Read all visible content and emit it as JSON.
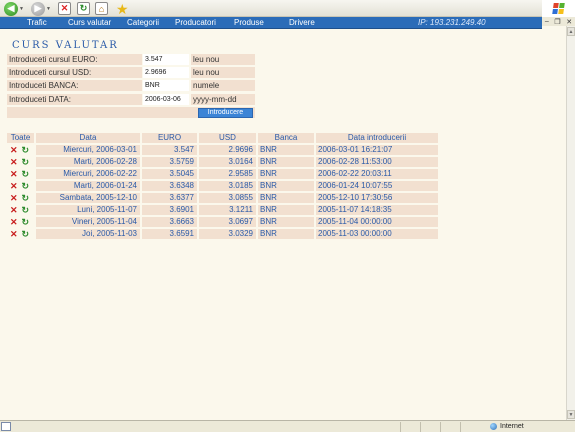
{
  "browser": {
    "toolbar_icons": [
      "back-arrow-icon",
      "forward-arrow-icon",
      "stop-icon",
      "refresh-icon",
      "home-icon",
      "favorites-star-icon"
    ],
    "status_zone": "Internet"
  },
  "nav": {
    "items": [
      "Trafic",
      "Curs valutar",
      "Categorii",
      "Producatori",
      "Produse",
      "Drivere"
    ],
    "ip": "IP:  193.231.249.40"
  },
  "page": {
    "title": "CURS VALUTAR"
  },
  "form": {
    "euro": {
      "label": "Introduceti cursul EURO:",
      "value": "3.547",
      "unit": "leu nou"
    },
    "usd": {
      "label": "Introduceti cursul USD:",
      "value": "2.9696",
      "unit": "leu nou"
    },
    "bank": {
      "label": "Introduceti BANCA:",
      "value": "BNR",
      "unit": "numele"
    },
    "date": {
      "label": "Introduceti DATA:",
      "value": "2006-03-06",
      "unit": "yyyy-mm-dd"
    },
    "submit": "Introducere"
  },
  "table": {
    "headers": {
      "all": "Toate",
      "date": "Data",
      "euro": "EURO",
      "usd": "USD",
      "bank": "Banca",
      "entry_date": "Data introducerii"
    },
    "rows": [
      {
        "date": "Miercuri, 2006-03-01",
        "euro": "3.547",
        "usd": "2.9696",
        "bank": "BNR",
        "entry": "2006-03-01 16:21:07"
      },
      {
        "date": "Marti, 2006-02-28",
        "euro": "3.5759",
        "usd": "3.0164",
        "bank": "BNR",
        "entry": "2006-02-28 11:53:00"
      },
      {
        "date": "Miercuri, 2006-02-22",
        "euro": "3.5045",
        "usd": "2.9585",
        "bank": "BNR",
        "entry": "2006-02-22 20:03:11"
      },
      {
        "date": "Marti, 2006-01-24",
        "euro": "3.6348",
        "usd": "3.0185",
        "bank": "BNR",
        "entry": "2006-01-24 10:07:55"
      },
      {
        "date": "Sambata, 2005-12-10",
        "euro": "3.6377",
        "usd": "3.0855",
        "bank": "BNR",
        "entry": "2005-12-10 17:30:56"
      },
      {
        "date": "Luni, 2005-11-07",
        "euro": "3.6901",
        "usd": "3.1211",
        "bank": "BNR",
        "entry": "2005-11-07 14:18:35"
      },
      {
        "date": "Vineri, 2005-11-04",
        "euro": "3.6663",
        "usd": "3.0697",
        "bank": "BNR",
        "entry": "2005-11-04 00:00:00"
      },
      {
        "date": "Joi, 2005-11-03",
        "euro": "3.6591",
        "usd": "3.0329",
        "bank": "BNR",
        "entry": "2005-11-03 00:00:00"
      }
    ]
  },
  "icons": {
    "delete": "delete-x-icon",
    "edit": "refresh-edit-icon"
  }
}
